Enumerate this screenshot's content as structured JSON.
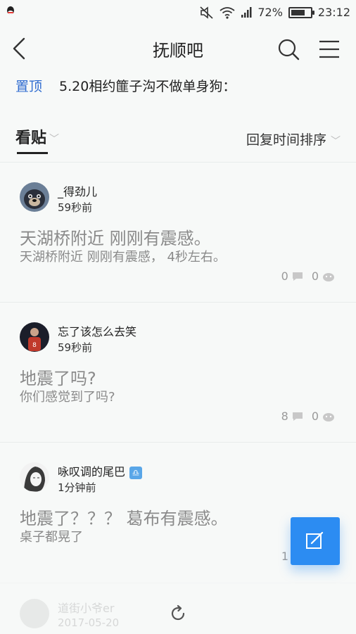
{
  "status": {
    "battery": "72%",
    "battery_level": 0.72,
    "time": "23:12"
  },
  "nav": {
    "title": "抚顺吧"
  },
  "pinned": {
    "tag": "置顶",
    "text": "5.20相约篚子沟不做单身狗："
  },
  "tabs": {
    "left": "看贴",
    "right": "回复时间排序"
  },
  "posts": [
    {
      "user": "_得劲儿",
      "time": "59秒前",
      "title": "天湖桥附近  刚刚有震感。",
      "body": "天湖桥附近 刚刚有震感， 4秒左右。",
      "comments": "0",
      "likes": "0"
    },
    {
      "user": "忘了该怎么去笑",
      "time": "59秒前",
      "title": "地震了吗?",
      "body": "你们感觉到了吗?",
      "comments": "8",
      "likes": "0"
    },
    {
      "user": "咏叹调的尾巴",
      "time": "1分钟前",
      "title": "地震了？？？ 葛布有震感。",
      "body": "桌子都晃了",
      "comments": "1",
      "badge": "♎"
    }
  ],
  "faded_post": {
    "user": "道街小爷er",
    "time": "2017-05-20"
  },
  "colors": {
    "accent": "#2c8cf2",
    "pinned": "#2f6cd0"
  }
}
